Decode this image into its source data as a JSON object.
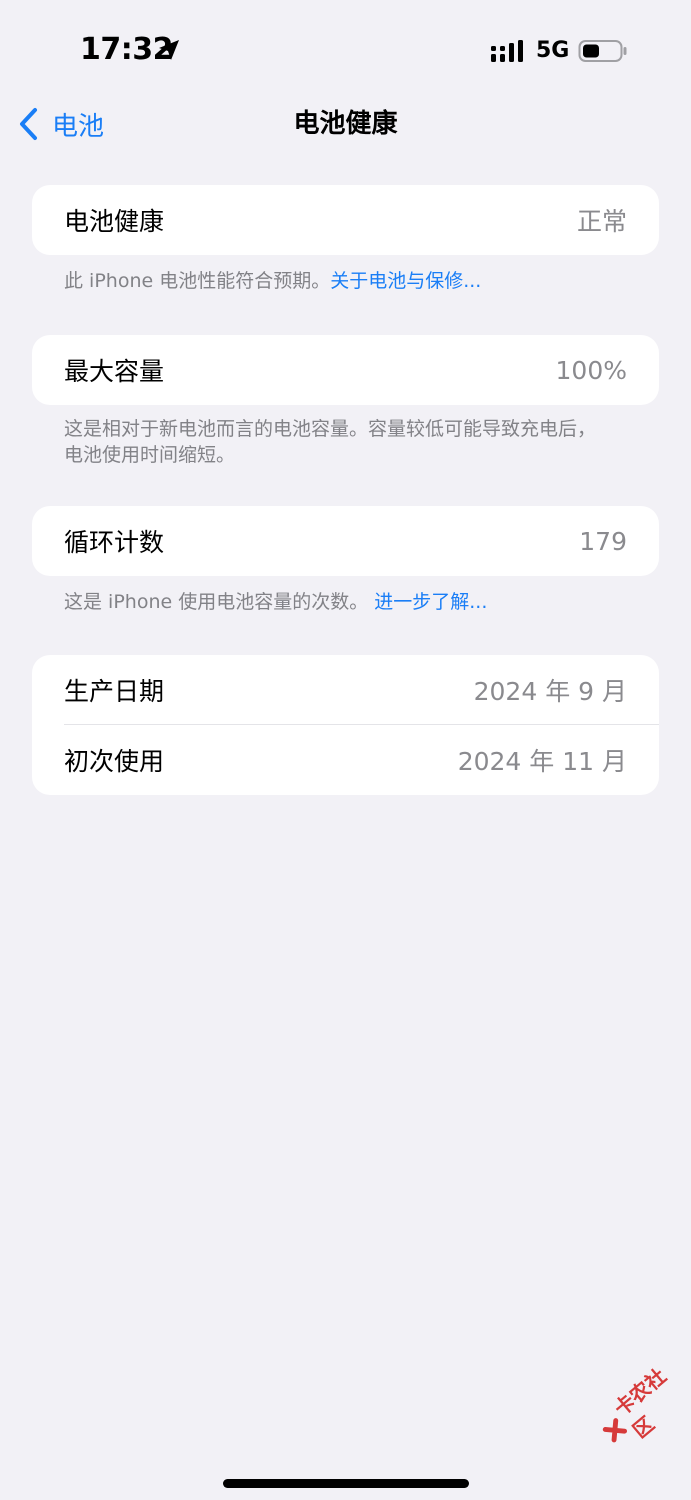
{
  "status_bar": {
    "time": "17:32",
    "network": "5G",
    "icons": [
      "location-arrow-icon",
      "signal-icon",
      "battery-icon"
    ]
  },
  "nav": {
    "back_label": "电池",
    "title": "电池健康"
  },
  "health_card": {
    "label": "电池健康",
    "value": "正常"
  },
  "health_note": {
    "text": "此 iPhone 电池性能符合预期。",
    "link": "关于电池与保修..."
  },
  "capacity_card": {
    "label": "最大容量",
    "value": "100%"
  },
  "capacity_note": {
    "line1": "这是相对于新电池而言的电池容量。容量较低可能导致充电后，",
    "line2": "电池使用时间缩短。"
  },
  "cycle_card": {
    "label": "循环计数",
    "value": "179"
  },
  "cycle_note": {
    "text": "这是 iPhone 使用电池容量的次数。",
    "link": "进一步了解..."
  },
  "dates_card": {
    "rows": [
      {
        "label": "生产日期",
        "value": "2024 年 9 月"
      },
      {
        "label": "初次使用",
        "value": "2024 年 11 月"
      }
    ]
  },
  "watermark": {
    "text": "卡农社区"
  },
  "colors": {
    "accent": "#1a7ef6",
    "background": "#f2f1f6",
    "secondary_text": "#8a8a8e"
  }
}
